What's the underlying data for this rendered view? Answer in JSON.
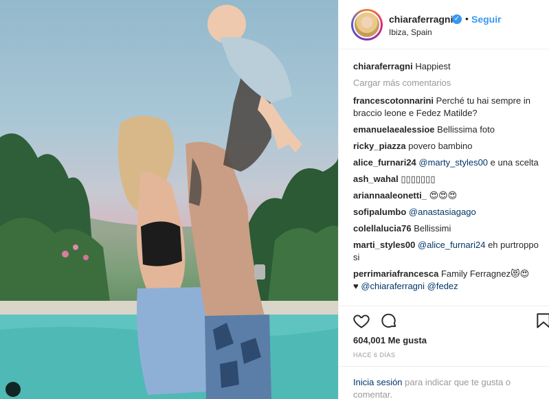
{
  "header": {
    "username": "chiaraferragni",
    "verified_glyph": "✓",
    "separator": "•",
    "follow_label": "Seguir",
    "location": "Ibiza, Spain"
  },
  "caption": {
    "user": "chiaraferragni",
    "text": "Happiest"
  },
  "load_more_label": "Cargar más comentarios",
  "comments": [
    {
      "user": "francescotonnarini",
      "text": "Perché tu hai sempre in braccio leone e Fedez Matilde?",
      "mentions": ""
    },
    {
      "user": "emanuelaealessioe",
      "text": "Bellissima foto",
      "mentions": ""
    },
    {
      "user": "ricky_piazza",
      "text": "povero bambino",
      "mentions": ""
    },
    {
      "user": "alice_furnari24",
      "mentions": "@marty_styles00",
      "text": "e una scelta"
    },
    {
      "user": "ash_wahal",
      "text": "▯▯▯▯▯▯▯",
      "mentions": ""
    },
    {
      "user": "ariannaaleonetti_",
      "text": "😍😍😍",
      "mentions": ""
    },
    {
      "user": "sofipalumbo",
      "mentions": "@anastasiagago",
      "text": ""
    },
    {
      "user": "colellalucia76",
      "text": "Bellissimi",
      "mentions": ""
    },
    {
      "user": "marti_styles00",
      "mentions": "@alice_furnari24",
      "text": "eh purtroppo si"
    },
    {
      "user": "perrimariafrancesca",
      "text": "Family Ferragnez😻😍",
      "mentions": ""
    }
  ],
  "last_line": {
    "prefix": "♥",
    "mention1": "@chiaraferragni",
    "mention2": "@fedez"
  },
  "icons": {
    "like": "heart-icon",
    "comment": "comment-icon",
    "save": "bookmark-icon"
  },
  "likes_label": "604,001 Me gusta",
  "time_ago": "HACE 6 DÍAS",
  "login": {
    "link": "Inicia sesión",
    "text": "para indicar que te gusta o comentar."
  },
  "colors": {
    "link": "#3897f0",
    "mention": "#003569",
    "muted": "#999999",
    "text": "#262626"
  }
}
